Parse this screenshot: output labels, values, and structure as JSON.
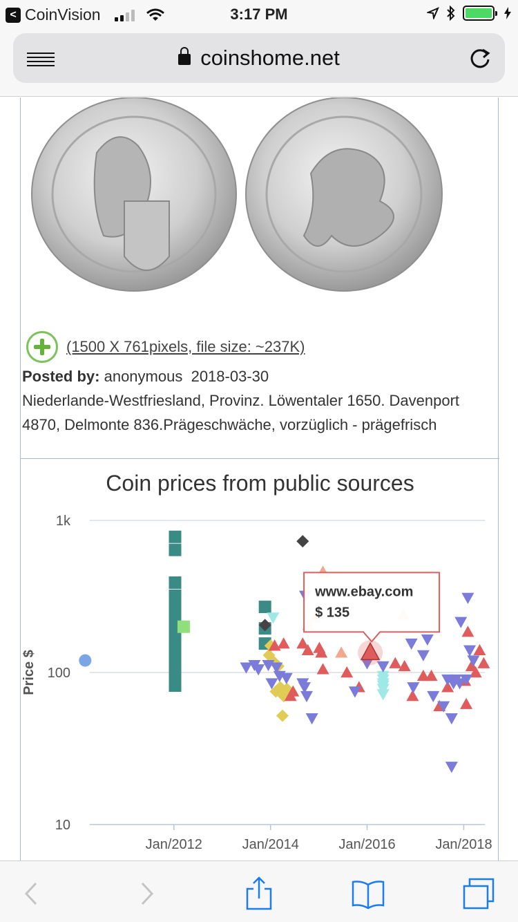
{
  "status_bar": {
    "app": "CoinVision",
    "time": "3:17 PM"
  },
  "browser": {
    "url": "coinshome.net"
  },
  "post": {
    "image_info": "(1500 X 761pixels, file size: ~237K)",
    "posted_by_label": "Posted by:",
    "author": "anonymous",
    "date": "2018-03-30",
    "description": "Niederlande-Westfriesland, Provinz. Löwentaler 1650. Davenport 4870, Delmonte 836.Prägeschwäche, vorzüglich - prägefrisch"
  },
  "chart_title": "Coin prices from public sources",
  "tooltip": {
    "source": "www.ebay.com",
    "price": "$ 135"
  },
  "chart_data": {
    "type": "scatter",
    "title": "Coin prices from public sources",
    "ylabel": "Price $",
    "y_scale": "log",
    "ylim": [
      10,
      1000
    ],
    "y_ticks": [
      "10",
      "100",
      "1k"
    ],
    "x_ticks": [
      "Jan/2012",
      "Jan/2014",
      "Jan/2016",
      "Jan/2018"
    ],
    "grid": true,
    "legend": "none",
    "series": [
      {
        "marker": "circle",
        "color": "#7aa6e6",
        "points": [
          [
            "2010-03-01",
            120
          ]
        ]
      },
      {
        "marker": "square",
        "color": "#3a8a86",
        "points": [
          [
            "2012-01-10",
            780
          ],
          [
            "2012-01-10",
            640
          ],
          [
            "2012-01-10",
            390
          ],
          [
            "2012-01-10",
            320
          ],
          [
            "2012-01-10",
            280
          ],
          [
            "2012-01-10",
            250
          ],
          [
            "2012-01-10",
            220
          ],
          [
            "2012-01-10",
            200
          ],
          [
            "2012-01-10",
            180
          ],
          [
            "2012-01-10",
            160
          ],
          [
            "2012-01-10",
            145
          ],
          [
            "2012-01-10",
            130
          ],
          [
            "2012-01-10",
            118
          ],
          [
            "2012-01-10",
            108
          ],
          [
            "2012-01-10",
            98
          ],
          [
            "2012-01-10",
            90
          ],
          [
            "2012-01-10",
            82
          ],
          [
            "2013-11-20",
            270
          ],
          [
            "2013-11-20",
            195
          ],
          [
            "2013-11-20",
            155
          ]
        ]
      },
      {
        "marker": "square",
        "color": "#8fe07a",
        "points": [
          [
            "2012-03-15",
            200
          ]
        ]
      },
      {
        "marker": "diamond",
        "color": "#444444",
        "points": [
          [
            "2014-09-01",
            730
          ],
          [
            "2013-11-20",
            205
          ]
        ]
      },
      {
        "marker": "diamond",
        "color": "#e0cc55",
        "points": [
          [
            "2014-01-15",
            120
          ],
          [
            "2014-03-01",
            110
          ],
          [
            "2014-02-10",
            75
          ],
          [
            "2014-03-15",
            80
          ],
          [
            "2014-04-10",
            70
          ],
          [
            "2014-05-05",
            78
          ],
          [
            "2014-01-01",
            150
          ],
          [
            "2013-12-20",
            130
          ],
          [
            "2014-04-01",
            52
          ]
        ]
      },
      {
        "marker": "triangle-up",
        "color": "#f2a88f",
        "points": [
          [
            "2015-02-01",
            460
          ],
          [
            "2014-10-15",
            205
          ],
          [
            "2015-06-20",
            135
          ],
          [
            "2016-10-01",
            240
          ],
          [
            "2014-12-01",
            230
          ]
        ]
      },
      {
        "marker": "triangle-down",
        "color": "#9ee8e6",
        "points": [
          [
            "2014-01-20",
            230
          ],
          [
            "2016-05-01",
            95
          ],
          [
            "2016-05-01",
            90
          ],
          [
            "2016-05-01",
            85
          ],
          [
            "2016-05-01",
            82
          ],
          [
            "2016-05-01",
            78
          ],
          [
            "2016-05-01",
            72
          ]
        ]
      },
      {
        "marker": "triangle-up",
        "color": "#e05c5c",
        "points": [
          [
            "2014-02-01",
            150
          ],
          [
            "2014-04-10",
            155
          ],
          [
            "2014-09-01",
            155
          ],
          [
            "2014-10-10",
            140
          ],
          [
            "2015-01-05",
            145
          ],
          [
            "2015-01-20",
            135
          ],
          [
            "2015-02-01",
            105
          ],
          [
            "2014-06-01",
            70
          ],
          [
            "2014-06-20",
            75
          ],
          [
            "2015-11-01",
            80
          ],
          [
            "2016-01-25",
            135
          ],
          [
            "2016-08-01",
            115
          ],
          [
            "2016-10-10",
            110
          ],
          [
            "2016-12-10",
            70
          ],
          [
            "2017-03-01",
            95
          ],
          [
            "2017-05-01",
            95
          ],
          [
            "2017-07-01",
            60
          ],
          [
            "2017-09-01",
            80
          ],
          [
            "2018-02-01",
            185
          ],
          [
            "2018-03-01",
            110
          ],
          [
            "2018-05-01",
            140
          ],
          [
            "2018-06-01",
            115
          ],
          [
            "2018-01-10",
            88
          ],
          [
            "2018-01-20",
            62
          ],
          [
            "2018-04-01",
            100
          ],
          [
            "2015-08-01",
            100
          ]
        ]
      },
      {
        "marker": "triangle-down",
        "color": "#7b7bd9",
        "points": [
          [
            "2013-07-01",
            108
          ],
          [
            "2013-09-01",
            112
          ],
          [
            "2013-10-01",
            105
          ],
          [
            "2013-12-15",
            112
          ],
          [
            "2014-02-15",
            108
          ],
          [
            "2014-01-10",
            85
          ],
          [
            "2014-03-10",
            95
          ],
          [
            "2014-05-01",
            92
          ],
          [
            "2014-09-01",
            85
          ],
          [
            "2014-09-15",
            80
          ],
          [
            "2014-10-01",
            70
          ],
          [
            "2014-11-10",
            50
          ],
          [
            "2014-09-20",
            320
          ],
          [
            "2016-01-01",
            115
          ],
          [
            "2015-10-01",
            75
          ],
          [
            "2016-12-01",
            155
          ],
          [
            "2016-12-15",
            80
          ],
          [
            "2017-04-01",
            165
          ],
          [
            "2017-03-01",
            130
          ],
          [
            "2017-05-15",
            70
          ],
          [
            "2017-08-01",
            60
          ],
          [
            "2017-09-01",
            90
          ],
          [
            "2017-10-01",
            50
          ],
          [
            "2017-10-15",
            85
          ],
          [
            "2017-11-01",
            90
          ],
          [
            "2017-12-01",
            85
          ],
          [
            "2018-01-20",
            90
          ],
          [
            "2018-02-15",
            140
          ],
          [
            "2018-03-15",
            120
          ],
          [
            "2017-10-01",
            24
          ],
          [
            "2017-12-10",
            215
          ],
          [
            "2018-02-01",
            310
          ],
          [
            "2016-05-01",
            110
          ]
        ]
      }
    ],
    "highlight": {
      "source": "www.ebay.com",
      "x": "2016-01-25",
      "y": 135
    }
  }
}
